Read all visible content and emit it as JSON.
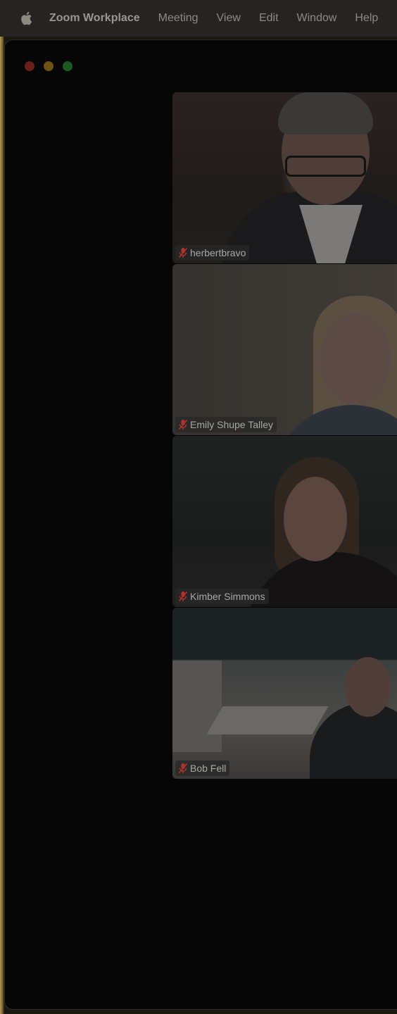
{
  "menubar": {
    "apple_icon": "apple-icon",
    "app_name": "Zoom Workplace",
    "items": [
      "Meeting",
      "View",
      "Edit",
      "Window",
      "Help"
    ]
  },
  "window": {
    "traffic_lights": {
      "close_color": "#6a1f1c",
      "minimize_color": "#6d5216",
      "zoom_color": "#1a5a20"
    }
  },
  "participants": [
    {
      "name": "herbertbravo",
      "muted": true
    },
    {
      "name": "Emily Shupe Talley",
      "muted": true
    },
    {
      "name": "Kimber Simmons",
      "muted": true
    },
    {
      "name": "Bob Fell",
      "muted": true
    }
  ],
  "colors": {
    "muted_icon": "#b3332b",
    "menubar_bg": "#252422",
    "window_bg": "#060606"
  }
}
